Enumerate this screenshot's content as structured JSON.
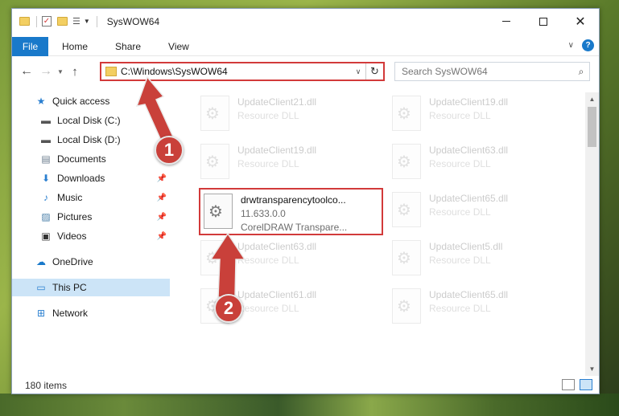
{
  "window": {
    "title": "SysWOW64",
    "controls": {
      "minimize": "—",
      "maximize": "□",
      "close": "✕"
    }
  },
  "ribbon": {
    "file_tab": "File",
    "tabs": [
      "Home",
      "Share",
      "View"
    ]
  },
  "navbar": {
    "address": "C:\\Windows\\SysWOW64",
    "search_placeholder": "Search SysWOW64"
  },
  "sidebar": {
    "items": [
      {
        "label": "Quick access",
        "icon": "star-icon"
      },
      {
        "label": "Local Disk (C:)",
        "icon": "drive-icon"
      },
      {
        "label": "Local Disk (D:)",
        "icon": "drive-icon"
      },
      {
        "label": "Documents",
        "icon": "documents-icon"
      },
      {
        "label": "Downloads",
        "icon": "download-icon"
      },
      {
        "label": "Music",
        "icon": "music-icon"
      },
      {
        "label": "Pictures",
        "icon": "pictures-icon"
      },
      {
        "label": "Videos",
        "icon": "videos-icon"
      },
      {
        "label": "OneDrive",
        "icon": "cloud-icon"
      },
      {
        "label": "This PC",
        "icon": "computer-icon"
      },
      {
        "label": "Network",
        "icon": "network-icon"
      }
    ]
  },
  "files": {
    "left": [
      {
        "name": "UpdateClient21.dll",
        "sub": "Resource DLL"
      },
      {
        "name": "UpdateClient19.dll",
        "sub": "Resource DLL"
      },
      {
        "name": "drwtransparencytoolco...",
        "sub": "11.633.0.0",
        "sub2": "CorelDRAW Transpare..."
      },
      {
        "name": "UpdateClient63.dll",
        "sub": "Resource DLL"
      },
      {
        "name": "UpdateClient61.dll",
        "sub": "Resource DLL"
      }
    ],
    "right": [
      {
        "name": "UpdateClient19.dll",
        "sub": "Resource DLL"
      },
      {
        "name": "UpdateClient63.dll",
        "sub": "Resource DLL"
      },
      {
        "name": "UpdateClient65.dll",
        "sub": "Resource DLL"
      },
      {
        "name": "UpdateClient5.dll",
        "sub": "Resource DLL"
      },
      {
        "name": "UpdateClient65.dll",
        "sub": "Resource DLL"
      }
    ]
  },
  "status": {
    "item_count": "180 items"
  },
  "annotations": {
    "step1": "1",
    "step2": "2"
  },
  "colors": {
    "accent": "#1979ca",
    "highlight": "#d23a3a",
    "badge": "#c9403a",
    "selection": "#cce4f7"
  }
}
